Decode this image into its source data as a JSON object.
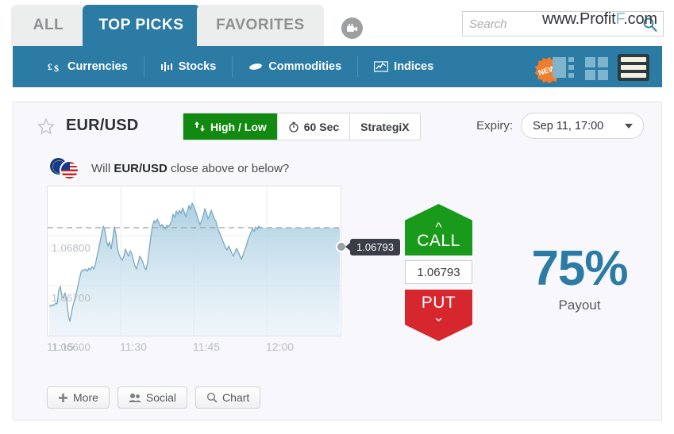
{
  "tabs": [
    {
      "label": "ALL",
      "active": false
    },
    {
      "label": "TOP PICKS",
      "active": true
    },
    {
      "label": "FAVORITES",
      "active": false
    }
  ],
  "search": {
    "placeholder": "Search",
    "value": ""
  },
  "watermark": {
    "part1": "www.Profit",
    "highlight": "F",
    "part2": ".com"
  },
  "nav": {
    "items": [
      {
        "label": "Currencies",
        "icon": "currency-icon"
      },
      {
        "label": "Stocks",
        "icon": "stocks-icon"
      },
      {
        "label": "Commodities",
        "icon": "commodities-icon"
      },
      {
        "label": "Indices",
        "icon": "indices-icon"
      }
    ],
    "new_badge": "NEW"
  },
  "asset": {
    "name": "EUR/USD",
    "trade_types": [
      {
        "label": "High / Low",
        "active": true,
        "icon": "highlow-icon"
      },
      {
        "label": "60 Sec",
        "active": false,
        "icon": "stopwatch-icon"
      },
      {
        "label": "StrategiX",
        "active": false,
        "icon": ""
      }
    ],
    "expiry_label": "Expiry:",
    "expiry_value": "Sep 11, 17:00",
    "question_prefix": "Will ",
    "question_pair": "EUR/USD",
    "question_suffix": " close above or below?"
  },
  "trade": {
    "call_label": "CALL",
    "put_label": "PUT",
    "strike_price": "1.06793",
    "payout_value": "75%",
    "payout_caption": "Payout",
    "current_price_tag": "1.06793"
  },
  "bottom_buttons": [
    {
      "label": "More",
      "icon": "plus-icon"
    },
    {
      "label": "Social",
      "icon": "people-icon"
    },
    {
      "label": "Chart",
      "icon": "magnifier-icon"
    }
  ],
  "colors": {
    "brand_blue": "#2c7ba5",
    "call_green": "#1a9a1a",
    "put_red": "#d6272f",
    "badge_orange": "#ef7d2e"
  },
  "chart_data": {
    "type": "area",
    "title": "",
    "xlabel": "",
    "ylabel": "",
    "x_ticks": [
      "11:15",
      "11:30",
      "11:45",
      "12:00"
    ],
    "y_ticks": [
      "1.06800",
      "1.06700",
      "1.06600"
    ],
    "ylim": [
      1.0657,
      1.0686
    ],
    "current_price": 1.06793,
    "series": [
      {
        "name": "EUR/USD",
        "values": [
          1.06628,
          1.06626,
          1.0663,
          1.06629,
          1.06634,
          1.06633,
          1.0666,
          1.06668,
          1.0665,
          1.06645,
          1.06655,
          1.0664,
          1.06612,
          1.066,
          1.06618,
          1.06628,
          1.0664,
          1.06652,
          1.06666,
          1.0668,
          1.06694,
          1.067,
          1.06698,
          1.06702,
          1.06697,
          1.06703,
          1.067,
          1.06706,
          1.06702,
          1.0671,
          1.06726,
          1.0674,
          1.06756,
          1.06772,
          1.06788,
          1.06782,
          1.0676,
          1.06748,
          1.06756,
          1.06742,
          1.0676,
          1.06784,
          1.0677,
          1.06742,
          1.0673,
          1.06722,
          1.06718,
          1.06726,
          1.0674,
          1.06732,
          1.06726,
          1.06736,
          1.0673,
          1.06718,
          1.06706,
          1.067,
          1.06712,
          1.06726,
          1.06722,
          1.06714,
          1.06706,
          1.067,
          1.06716,
          1.06742,
          1.06768,
          1.06788,
          1.068,
          1.06794,
          1.06802,
          1.06796,
          1.06786,
          1.06792,
          1.06788,
          1.06782,
          1.0679,
          1.06786,
          1.06792,
          1.06798,
          1.06812,
          1.06806,
          1.06818,
          1.06812,
          1.0682,
          1.06814,
          1.06826,
          1.06818,
          1.06808,
          1.0682,
          1.06832,
          1.06824,
          1.06836,
          1.0683,
          1.06822,
          1.06812,
          1.068,
          1.06792,
          1.068,
          1.0681,
          1.06824,
          1.06816,
          1.06804,
          1.06812,
          1.06822,
          1.06814,
          1.06806,
          1.06794,
          1.06784,
          1.06776,
          1.06768,
          1.0676,
          1.06752,
          1.06748,
          1.06756,
          1.0675,
          1.06742,
          1.06736,
          1.06744,
          1.06752,
          1.06746,
          1.06738,
          1.0673,
          1.06738,
          1.06748,
          1.06756,
          1.06768,
          1.06776,
          1.06784,
          1.06792,
          1.06786,
          1.06794,
          1.0679,
          1.06796,
          1.06793
        ]
      }
    ],
    "grid": true,
    "legend": false,
    "reference_line": 1.06793
  }
}
